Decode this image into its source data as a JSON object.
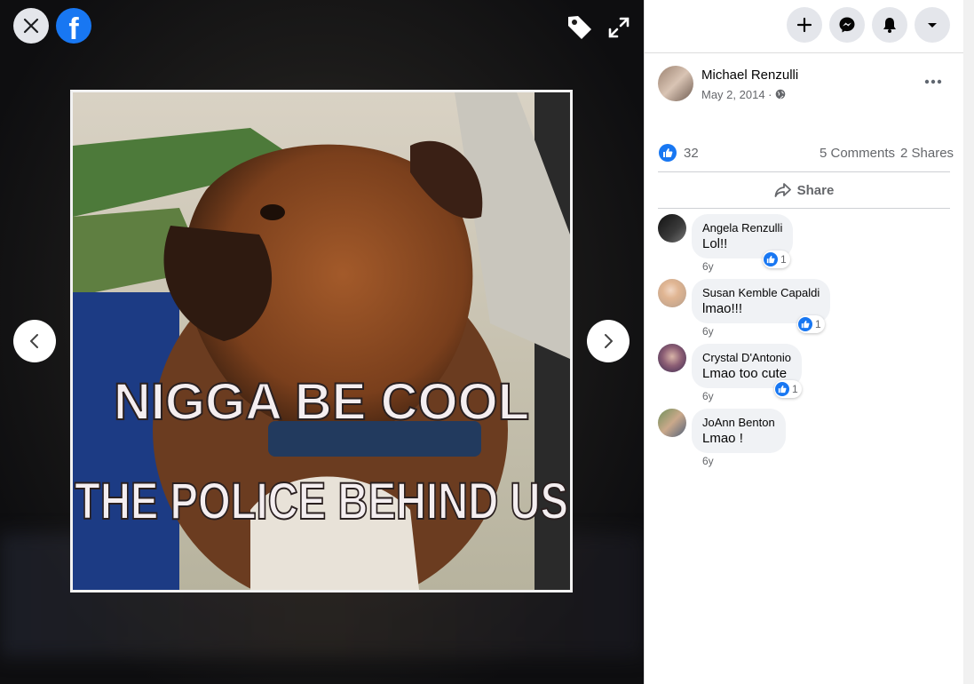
{
  "viewer": {
    "meme_line1": "NIGGA BE COOL",
    "meme_line2": "THE POLICE BEHIND US"
  },
  "post": {
    "author": "Michael Renzulli",
    "date": "May 2, 2014 ·",
    "like_count": "32",
    "comments": "5 Comments",
    "shares": "2 Shares",
    "share_label": "Share"
  },
  "comments": [
    {
      "name": "Angela Renzulli",
      "text": "Lol!!",
      "time": "6y",
      "reactions": "1"
    },
    {
      "name": "Susan Kemble Capaldi",
      "text": "lmao!!!",
      "time": "6y",
      "reactions": "1"
    },
    {
      "name": "Crystal D'Antonio",
      "text": "Lmao too cute",
      "time": "6y",
      "reactions": "1"
    },
    {
      "name": "JoAnn Benton",
      "text": "Lmao !",
      "time": "6y"
    }
  ],
  "icons": {
    "close": "close-icon",
    "logo": "facebook-logo",
    "tag": "tag-icon",
    "fullscreen": "expand-icon",
    "prev": "chevron-left-icon",
    "next": "chevron-right-icon",
    "create": "plus-icon",
    "messenger": "messenger-icon",
    "notifications": "bell-icon",
    "account": "caret-down-icon",
    "audience": "globe-icon",
    "more": "more-horizontal-icon",
    "like": "like-icon",
    "share": "share-icon"
  },
  "colors": {
    "brand": "#1877f2",
    "panel_bg": "#ffffff",
    "bubble_bg": "#f0f2f5"
  }
}
